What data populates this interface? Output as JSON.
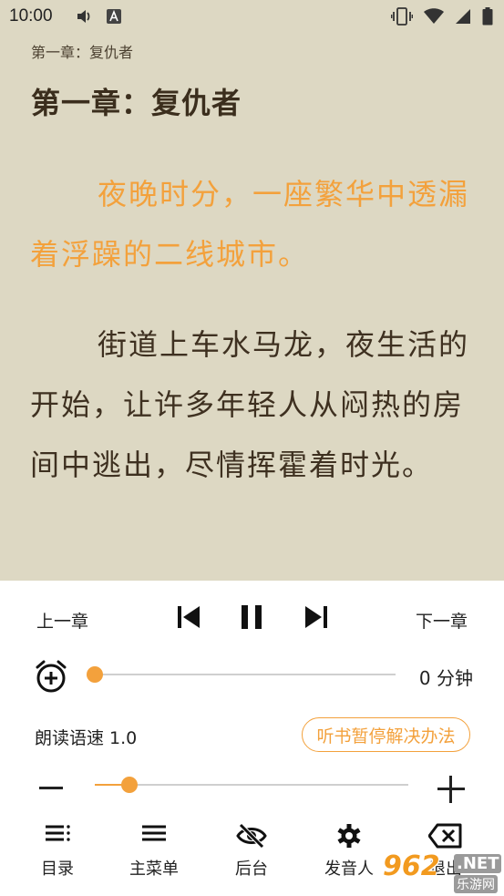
{
  "status_bar": {
    "time": "10:00",
    "left_icons": [
      "volume-icon",
      "font-a-icon"
    ],
    "right_icons": [
      "vibrate-icon",
      "wifi-icon",
      "signal-icon",
      "battery-icon"
    ]
  },
  "reader": {
    "header_chapter": "第一章：复仇者",
    "chapter_title": "第一章：复仇者",
    "paragraphs": [
      "夜晚时分，一座繁华中透漏着浮躁的二线城市。",
      "街道上车水马龙，夜生活的开始，让许多年轻人从闷热的房间中逃出，尽情挥霍着时光。"
    ],
    "highlight_color": "#f3a13c"
  },
  "player": {
    "prev_chapter_label": "上一章",
    "next_chapter_label": "下一章",
    "controls": [
      "skip-previous-icon",
      "pause-icon",
      "skip-next-icon"
    ],
    "timer_value": "0 分钟",
    "timer_fraction": 0.0,
    "speed_label": "朗读语速 1.0",
    "help_button_label": "听书暂停解决办法",
    "speed_fraction": 0.11
  },
  "bottom_nav": {
    "items": [
      {
        "label": "目录",
        "icon": "toc-icon"
      },
      {
        "label": "主菜单",
        "icon": "menu-icon"
      },
      {
        "label": "后台",
        "icon": "eye-off-icon"
      },
      {
        "label": "发音人",
        "icon": "gear-icon"
      },
      {
        "label": "退出",
        "icon": "backspace-icon"
      }
    ]
  },
  "watermark": {
    "main": "962",
    "net": ".NET",
    "sub": "乐游网"
  },
  "colors": {
    "page_bg": "#ddd8c3",
    "accent": "#f3a13c",
    "text": "#3e3020"
  }
}
